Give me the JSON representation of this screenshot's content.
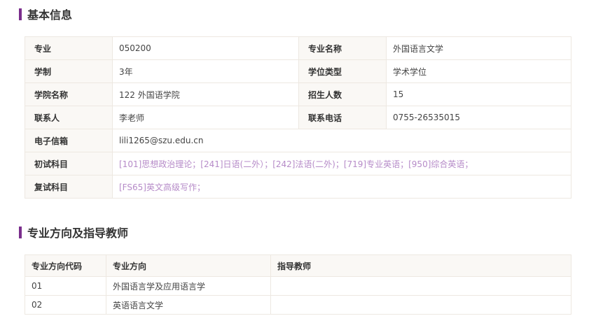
{
  "basic": {
    "title": "基本信息",
    "rows": [
      {
        "l1": "专业",
        "v1": "050200",
        "l2": "专业名称",
        "v2": "外国语言文学"
      },
      {
        "l1": "学制",
        "v1": "3年",
        "l2": "学位类型",
        "v2": "学术学位"
      },
      {
        "l1": "学院名称",
        "v1": "122 外国语学院",
        "l2": "招生人数",
        "v2": "15"
      },
      {
        "l1": "联系人",
        "v1": "李老师",
        "l2": "联系电话",
        "v2": "0755-26535015"
      }
    ],
    "email_label": "电子信箱",
    "email": "lili1265@szu.edu.cn",
    "exam1_label": "初试科目",
    "exam1": "[101]思想政治理论；[241]日语(二外）；[242]法语(二外)；[719]专业英语；[950]综合英语；",
    "exam2_label": "复试科目",
    "exam2": "[FS65]英文高级写作；"
  },
  "directions": {
    "title": "专业方向及指导教师",
    "headers": [
      "专业方向代码",
      "专业方向",
      "指导教师"
    ],
    "rows": [
      {
        "code": "01",
        "name": "外国语言学及应用语言学",
        "teacher": ""
      },
      {
        "code": "02",
        "name": "英语语言文学",
        "teacher": ""
      }
    ]
  },
  "colors": {
    "accent": "#7a2e8c",
    "link": "#b68bc8",
    "border": "#ede8e1",
    "label_bg": "#faf8f5"
  }
}
